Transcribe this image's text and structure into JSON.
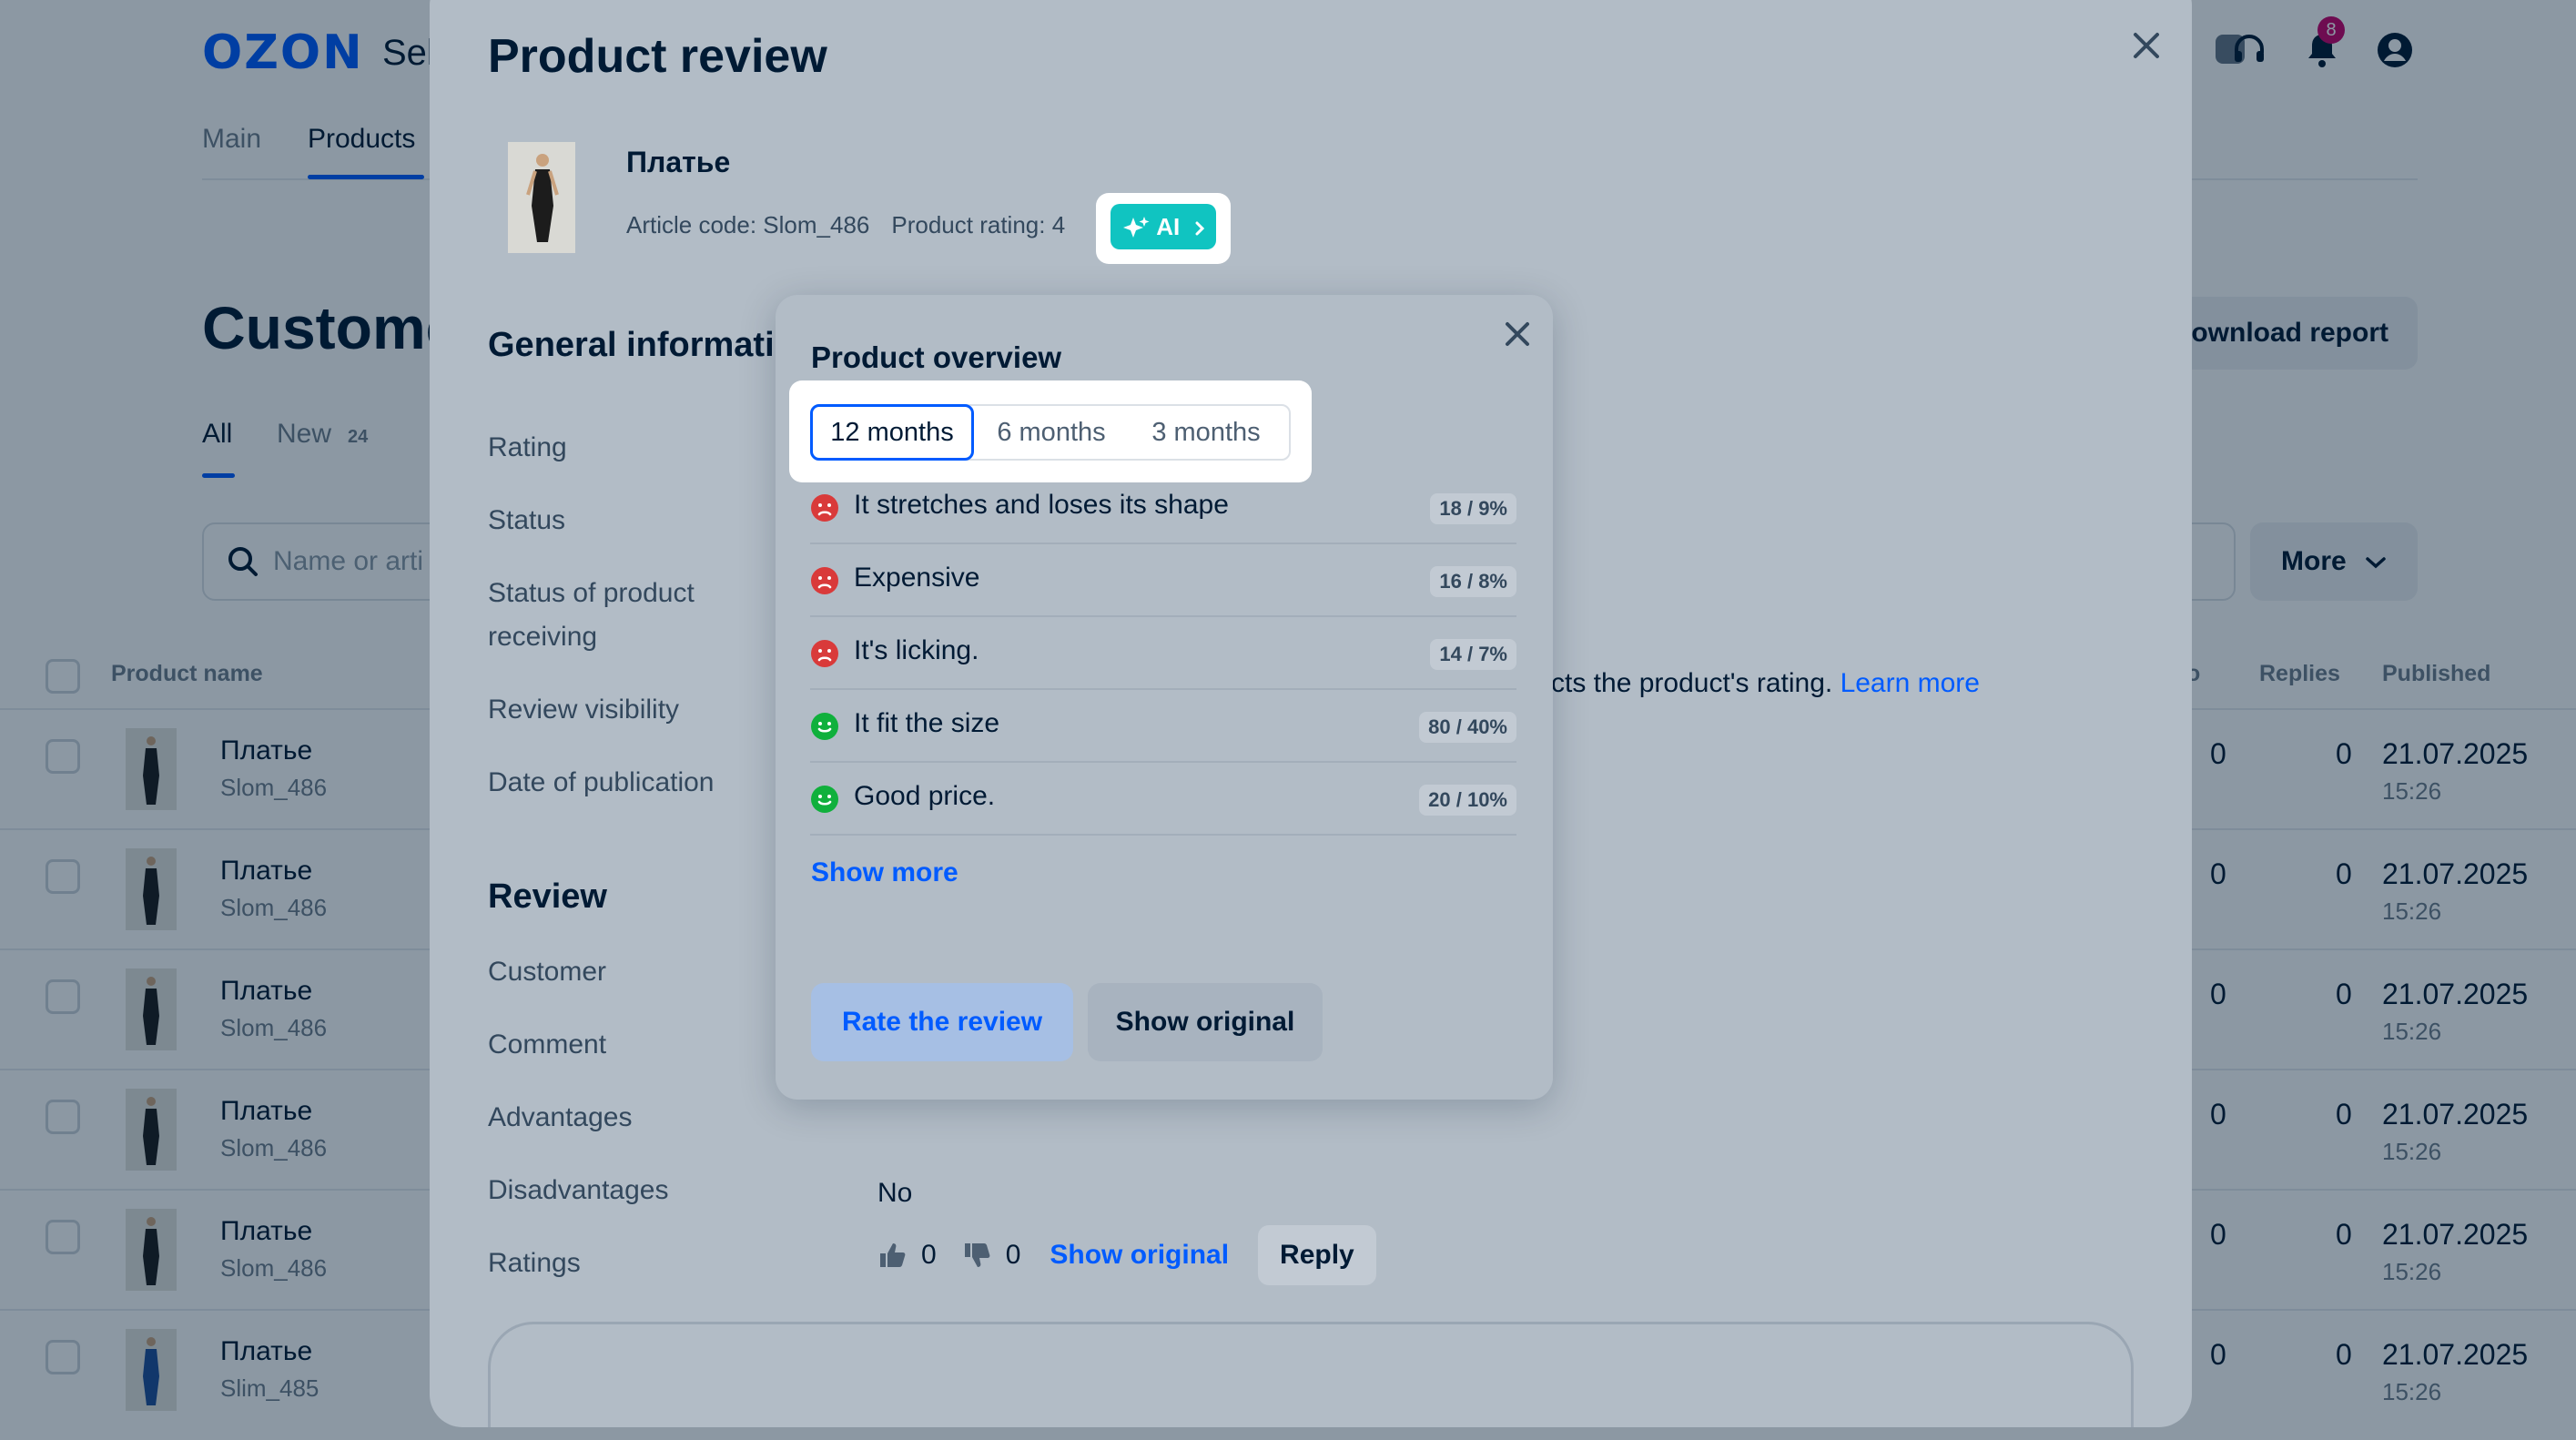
{
  "header": {
    "logo": "OZON",
    "logo_sub": "Sel",
    "notification_count": "8"
  },
  "nav": {
    "tabs": [
      "Main",
      "Products"
    ]
  },
  "page": {
    "title": "Custome",
    "download_label": "ownload report",
    "subtabs": {
      "all": "All",
      "new": "New",
      "new_count": "24"
    },
    "search_placeholder": "Name or arti",
    "more_label": "More"
  },
  "table": {
    "headers": {
      "product_name": "Product name",
      "partial": "o",
      "replies": "Replies",
      "published": "Published"
    },
    "rows": [
      {
        "name": "Платье",
        "sku": "Slom_486",
        "col_a": "0",
        "replies": "0",
        "date": "21.07.2025",
        "time": "15:26"
      },
      {
        "name": "Платье",
        "sku": "Slom_486",
        "col_a": "0",
        "replies": "0",
        "date": "21.07.2025",
        "time": "15:26"
      },
      {
        "name": "Платье",
        "sku": "Slom_486",
        "col_a": "0",
        "replies": "0",
        "date": "21.07.2025",
        "time": "15:26"
      },
      {
        "name": "Платье",
        "sku": "Slom_486",
        "col_a": "0",
        "replies": "0",
        "date": "21.07.2025",
        "time": "15:26"
      },
      {
        "name": "Платье",
        "sku": "Slom_486",
        "col_a": "0",
        "replies": "0",
        "date": "21.07.2025",
        "time": "15:26"
      },
      {
        "name": "Платье",
        "sku": "Slim_485",
        "col_a": "0",
        "replies": "0",
        "date": "21.07.2025",
        "time": "15:26"
      }
    ]
  },
  "modal": {
    "title": "Product review",
    "product": {
      "name": "Платье",
      "article": "Article code: Slom_486",
      "rating": "Product rating: 4",
      "ai_label": "AI"
    },
    "general_title": "General informati",
    "fields": {
      "rating": "Rating",
      "status": "Status",
      "status_receiving": "Status of product receiving",
      "visibility": "Review visibility",
      "date": "Date of publication"
    },
    "visibility_text": "cts the product's rating.",
    "learn_more": "Learn more",
    "review_title": "Review",
    "review_fields": {
      "customer": "Customer",
      "comment": "Comment",
      "advantages": "Advantages",
      "disadvantages": "Disadvantages",
      "ratings": "Ratings"
    },
    "disadvantages_value": "No",
    "likes": "0",
    "dislikes": "0",
    "show_original": "Show original",
    "reply": "Reply"
  },
  "overview": {
    "title": "Product overview",
    "periods": [
      "12 months",
      "6 months",
      "3 months"
    ],
    "selected_period": "12 months",
    "insights": [
      {
        "text": "It stretches and loses its shape",
        "stat": "18 / 9%",
        "sentiment": "negative"
      },
      {
        "text": "Expensive",
        "stat": "16 / 8%",
        "sentiment": "negative"
      },
      {
        "text": "It's licking.",
        "stat": "14 / 7%",
        "sentiment": "negative"
      },
      {
        "text": "It fit the size",
        "stat": "80 / 40%",
        "sentiment": "positive"
      },
      {
        "text": "Good price.",
        "stat": "20 / 10%",
        "sentiment": "positive"
      }
    ],
    "show_more": "Show more",
    "rate_label": "Rate the review",
    "orig_label": "Show original"
  },
  "colors": {
    "accent": "#005bff",
    "ai": "#10c4c1",
    "negative": "#d93a3a",
    "positive": "#10b03c",
    "badge": "#c8006a"
  },
  "icons": [
    "close-icon",
    "headset-icon",
    "bell-icon",
    "user-icon",
    "search-icon",
    "chevron-down-icon",
    "sparkle-icon",
    "chevron-right-icon",
    "sad-face-icon",
    "happy-face-icon",
    "thumbs-up-icon",
    "thumbs-down-icon"
  ]
}
